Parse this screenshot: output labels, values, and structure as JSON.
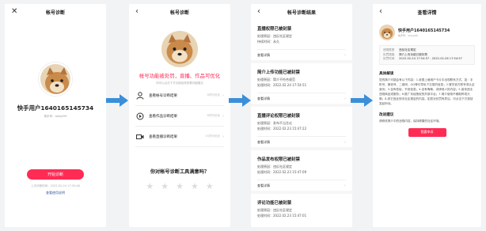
{
  "accent_color": "#fe2c55",
  "arrow_color": "#3b8fd9",
  "screen1": {
    "nav_title": "帐号诊断",
    "close_glyph": "✕",
    "user_name": "快手用户1640165145734",
    "uid": "快手号：daioyl99",
    "start_button": "开始诊断",
    "last_time": "上次诊断时间：2022-02-24 17:35:48",
    "help_link": "查看使用说明"
  },
  "screen2": {
    "nav_title": "帐号诊断",
    "back_glyph": "‹",
    "headline": "帐号功能被处罚，直播、作品可优化",
    "subtitle": "你可以点击下方功能检测查看详细建议",
    "items": [
      {
        "label": "查看帐号诊断结果",
        "count": "6项可优化",
        "icon": "person-icon"
      },
      {
        "label": "查看作品诊断结果",
        "count": "6项可优化",
        "icon": "video-icon"
      },
      {
        "label": "查看直播诊断结果",
        "count": "25项可优化",
        "icon": "camera-icon"
      }
    ],
    "question": "你对帐号诊断工具满意吗？",
    "stars": [
      "★",
      "★",
      "★",
      "★",
      "★"
    ]
  },
  "screen3": {
    "nav_title": "帐号诊断结果",
    "back_glyph": "‹",
    "sections": [
      {
        "title": "直播权限已被封禁",
        "lines": [
          "处理原因：违反社区规定",
          "持续时间：永久"
        ],
        "view": "查看详情"
      },
      {
        "title": "简介上传功能已被封禁",
        "lines": [
          "处理原因：简介不符合规范",
          "处理时间：2022.02.24 17:54:51"
        ],
        "view": "查看详情"
      },
      {
        "title": "直播评论权限已被封禁",
        "lines": [
          "处理原因：发布不当言论",
          "处理时间：2022.02.23 15:47:22"
        ],
        "view": "查看详情"
      },
      {
        "title": "作品发布权限已被封禁",
        "lines": [
          "处理原因：违反社区规定",
          "处理时间：2022.02.23 15:47:09"
        ],
        "view": "查看详情"
      },
      {
        "title": "评论功能已被封禁",
        "lines": [
          "处理原因：违反社区规定",
          "处理时间：2022.02.23 15:47:01"
        ],
        "view": ""
      }
    ]
  },
  "screen4": {
    "nav_title": "查看详情",
    "back_glyph": "‹",
    "user_name": "快手用户1640165145734",
    "uid": "快手号：daioyl99",
    "rows": [
      {
        "k": "违规类型",
        "v": "违反社区规定"
      },
      {
        "k": "处罚措施",
        "v": "简介上传功能已被封禁"
      },
      {
        "k": "处罚时间",
        "v": "2022-02-24 17:54:57 - 2022-02-26 17:54:57"
      }
    ],
    "section1": "具体解读",
    "paragraph": "您的简介可能会有以下内容：1.收费上墙用户卡片中出现联系方式，如：手机号、微信号、二维码、QQ等引导私下交易的信息；2.冒充官方账号或认证身份；3.含有低俗、不良信息；4.含有侮辱、诽谤他人的内容；5.宣传违法违规商品或服务；6.推广未经授权的外部平台；7.简介使用不雅昵称或头像；8.其它违反快手社区规定的内容。如您对处罚有异议，可点击下方按钮发起申诉。",
    "section2": "改进建议",
    "advice": "请修改简介中的违规内容，保持健康的社区环境。",
    "button": "我要申诉"
  }
}
